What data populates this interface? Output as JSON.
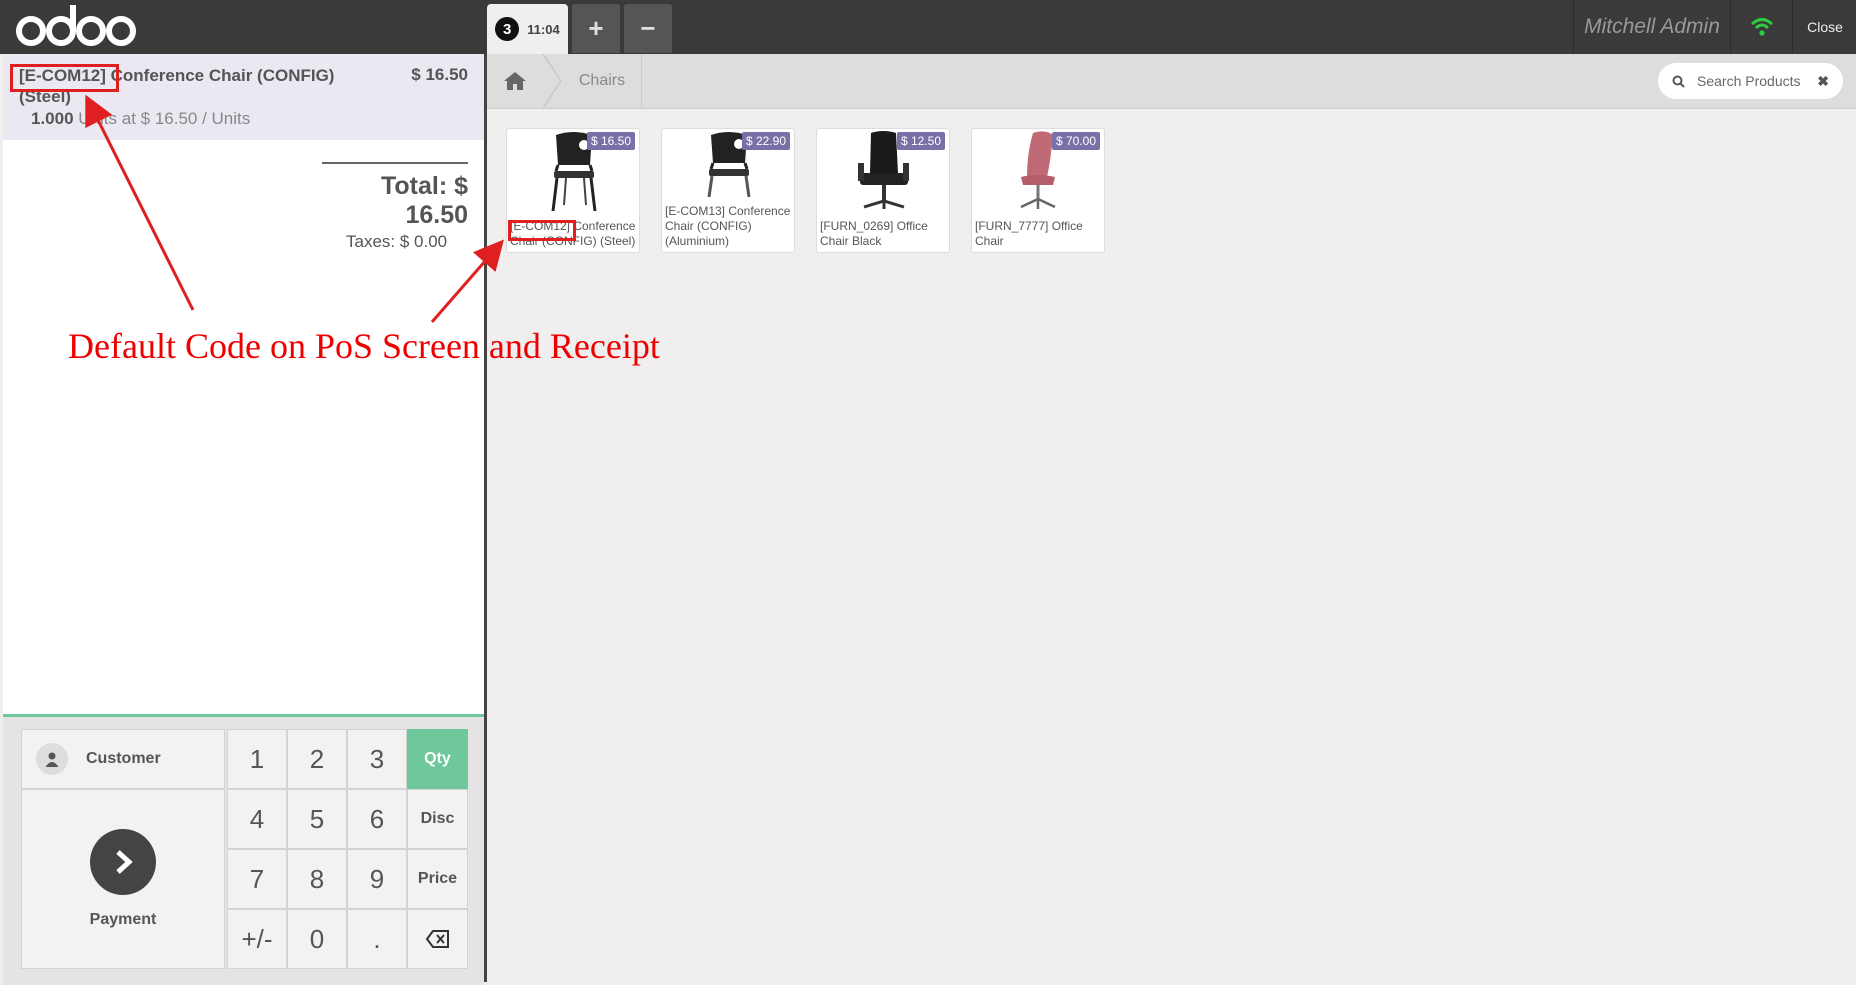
{
  "topbar": {
    "logo_text": "odoo",
    "order_tab": {
      "number": "3",
      "time": "11:04"
    },
    "add_order_icon": "plus-icon",
    "remove_order_icon": "minus-icon",
    "user_name": "Mitchell Admin",
    "wifi_icon": "wifi-icon",
    "wifi_color": "#2ecc40",
    "close_label": "Close"
  },
  "order": {
    "line": {
      "name": "[E-COM12] Conference Chair (CONFIG) (Steel)",
      "price": "$ 16.50",
      "qty": "1.000",
      "unit_info": "Units at $ 16.50 / Units"
    },
    "total": "Total: $ 16.50",
    "taxes": "Taxes: $ 0.00"
  },
  "controls": {
    "customer_label": "Customer",
    "payment_label": "Payment",
    "numpad": [
      "1",
      "2",
      "3",
      "4",
      "5",
      "6",
      "7",
      "8",
      "9",
      "+/-",
      "0",
      "."
    ],
    "modes": [
      "Qty",
      "Disc",
      "Price"
    ],
    "active_mode": "Qty",
    "accent_color": "#6ec89b"
  },
  "catalog": {
    "home_icon": "home-icon",
    "breadcrumb": "Chairs",
    "search_placeholder": "Search Products",
    "products": [
      {
        "price": "$ 16.50",
        "name": "[E-COM12] Conference Chair (CONFIG) (Steel)"
      },
      {
        "price": "$ 22.90",
        "name": "[E-COM13] Conference Chair (CONFIG) (Aluminium)"
      },
      {
        "price": "$ 12.50",
        "name": "[FURN_0269] Office Chair Black"
      },
      {
        "price": "$ 70.00",
        "name": "[FURN_7777] Office Chair"
      }
    ]
  },
  "annotation": {
    "text": "Default Code on PoS Screen and Receipt",
    "color": "#e02020"
  }
}
